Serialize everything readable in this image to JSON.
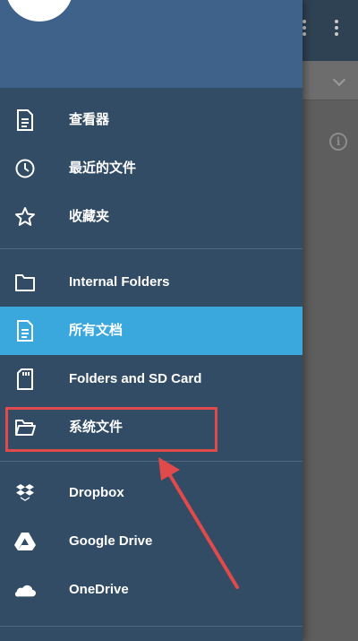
{
  "drawer": {
    "items": [
      {
        "label": "查看器",
        "icon": "document-icon"
      },
      {
        "label": "最近的文件",
        "icon": "clock-icon"
      },
      {
        "label": "收藏夹",
        "icon": "star-icon"
      },
      {
        "label": "Internal Folders",
        "icon": "folder-icon"
      },
      {
        "label": "所有文档",
        "icon": "document-icon",
        "active": true
      },
      {
        "label": "Folders and SD Card",
        "icon": "sd-card-icon"
      },
      {
        "label": "系统文件",
        "icon": "folder-open-icon",
        "highlighted": true
      },
      {
        "label": "Dropbox",
        "icon": "dropbox-icon"
      },
      {
        "label": "Google Drive",
        "icon": "google-drive-icon"
      },
      {
        "label": "OneDrive",
        "icon": "onedrive-icon"
      }
    ]
  },
  "colors": {
    "drawer_bg": "#324c65",
    "drawer_header": "#3e6289",
    "active_item": "#3aa8dd",
    "annotation": "#e04a4a"
  }
}
